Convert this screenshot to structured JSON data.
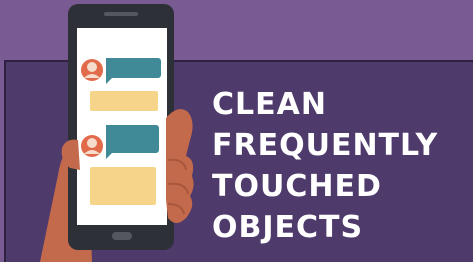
{
  "headline": {
    "lines": [
      "CLEAN",
      "FREQUENTLY",
      "TOUCHED",
      "OBJECTS"
    ]
  },
  "colors": {
    "background_top": "#7a5a92",
    "panel": "#4e3a6b",
    "phone_body": "#2e3038",
    "screen": "#ffffff",
    "bubble_teal": "#3f8a96",
    "bubble_yellow": "#f6d48a",
    "avatar": "#e06a4a",
    "hand": "#c46a4c",
    "text": "#ffffff"
  },
  "icons": [
    "phone-icon",
    "hand-icon",
    "avatar-icon",
    "chat-bubble-icon"
  ]
}
